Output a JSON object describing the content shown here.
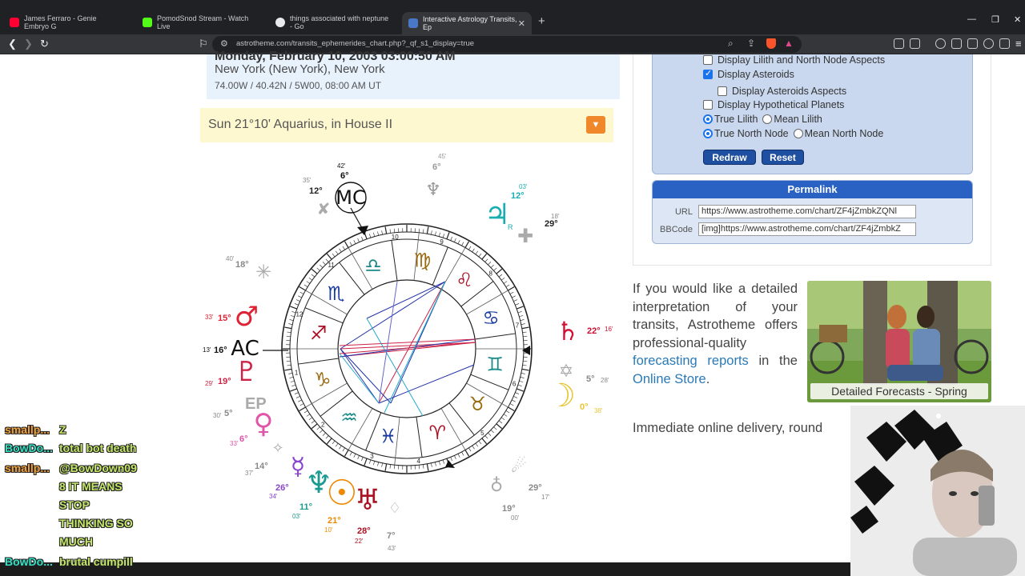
{
  "browser": {
    "tabs": [
      {
        "label": "James Ferraro - Genie Embryo G",
        "favicon_color": "#ff0033"
      },
      {
        "label": "PomodSnod Stream - Watch Live",
        "favicon_color": "#53fc18"
      },
      {
        "label": "things associated with neptune - Go",
        "favicon_color": "#e8eaed"
      },
      {
        "label": "Interactive Astrology Transits, Ep",
        "favicon_color": "#4a78c9"
      }
    ],
    "url": "astrotheme.com/transits_ephemerides_chart.php?_qf_s1_display=true"
  },
  "location": {
    "date": "Monday, February 10, 2003 03:00:50 AM",
    "city": "New York (New York), New York",
    "coords": "74.00W / 40.42N / 5W00, 08:00 AM UT"
  },
  "sun_line": "Sun 21°10' Aquarius, in House II",
  "chart": {
    "angles": {
      "mc": "MC",
      "ac": "AC"
    },
    "house_numbers": [
      "1",
      "2",
      "3",
      "4",
      "5",
      "6",
      "7",
      "8",
      "9",
      "10",
      "11",
      "12"
    ],
    "planet_labels": [
      {
        "glyph": "♆",
        "deg": "6°",
        "min": "45'",
        "color": "#999999"
      },
      {
        "glyph": "MC",
        "deg": "6°",
        "min": "42'",
        "color": "#111111"
      },
      {
        "glyph": "♃",
        "deg": "12°",
        "min": "03'",
        "color": "#1aaeb0"
      },
      {
        "glyph": "♄",
        "deg": "22°",
        "min": "16'",
        "color": "#cc1133"
      },
      {
        "glyph": "☽",
        "deg": "0°",
        "min": "38'",
        "color": "#e8c431"
      },
      {
        "glyph": "♀",
        "deg": "6°",
        "min": "33'",
        "color": "#e055a8"
      },
      {
        "glyph": "☿",
        "deg": "26°",
        "min": "34'",
        "color": "#8844cc"
      },
      {
        "glyph": "♆",
        "deg": "11°",
        "min": "03'",
        "color": "#1a9a90"
      },
      {
        "glyph": "☉",
        "deg": "21°",
        "min": "10'",
        "color": "#ee8800"
      },
      {
        "glyph": "♅",
        "deg": "28°",
        "min": "22'",
        "color": "#aa1122"
      },
      {
        "glyph": "♂",
        "deg": "15°",
        "min": "33'",
        "color": "#dd2233"
      },
      {
        "glyph": "AC",
        "deg": "16°",
        "min": "13'",
        "color": "#111111"
      },
      {
        "glyph": "♇",
        "deg": "19°",
        "min": "29'",
        "color": "#cc2244"
      }
    ],
    "extra_labels": [
      "12°",
      "35'",
      "29°",
      "18'",
      "18°",
      "40'",
      "5°",
      "28'",
      "5°",
      "30'",
      "14°",
      "37'",
      "7°",
      "43'",
      "19°",
      "00'",
      "29°",
      "17'",
      "EP",
      "R"
    ]
  },
  "options": {
    "lilith_aspects": {
      "label": "Display Lilith and North Node Aspects",
      "checked": false
    },
    "asteroids": {
      "label": "Display Asteroids",
      "checked": true
    },
    "asteroid_aspects": {
      "label": "Display Asteroids Aspects",
      "checked": false
    },
    "hypothetical": {
      "label": "Display Hypothetical Planets",
      "checked": false
    },
    "true_lilith": "True Lilith",
    "mean_lilith": "Mean Lilith",
    "true_node": "True North Node",
    "mean_node": "Mean North Node",
    "redraw": "Redraw",
    "reset": "Reset"
  },
  "permalink": {
    "title": "Permalink",
    "url_label": "URL",
    "url_value": "https://www.astrotheme.com/chart/ZF4jZmbkZQNl",
    "bbcode_label": "BBCode",
    "bbcode_value": "[img]https://www.astrotheme.com/chart/ZF4jZmbkZ"
  },
  "promo": {
    "text_1": "If you would like a detailed interpretation of your transits, Astrotheme offers professional-quality",
    "link_1": "forecasting reports",
    "text_2": "in the",
    "link_2": "Online Store",
    "text_3": ".",
    "photo_caption": "Detailed Forecasts - Spring",
    "delivery": "Immediate online delivery, round"
  },
  "chat": [
    {
      "user": "smallp...",
      "user_color": "#f2a23c",
      "msg": "Z"
    },
    {
      "user": "BowDo...",
      "user_color": "#34e0c4",
      "msg": "total bot death"
    },
    {
      "user": "smallp...",
      "user_color": "#f2a23c",
      "msg": "@BowDown09"
    },
    {
      "user": "",
      "user_color": "#c6e86a",
      "msg": "8 IT MEANS"
    },
    {
      "user": "",
      "user_color": "#c6e86a",
      "msg": "STOP"
    },
    {
      "user": "",
      "user_color": "#c6e86a",
      "msg": "THINKING SO"
    },
    {
      "user": "",
      "user_color": "#c6e86a",
      "msg": "MUCH"
    },
    {
      "user": "BowDo...",
      "user_color": "#34e0c4",
      "msg": "brutal cumpill"
    }
  ]
}
